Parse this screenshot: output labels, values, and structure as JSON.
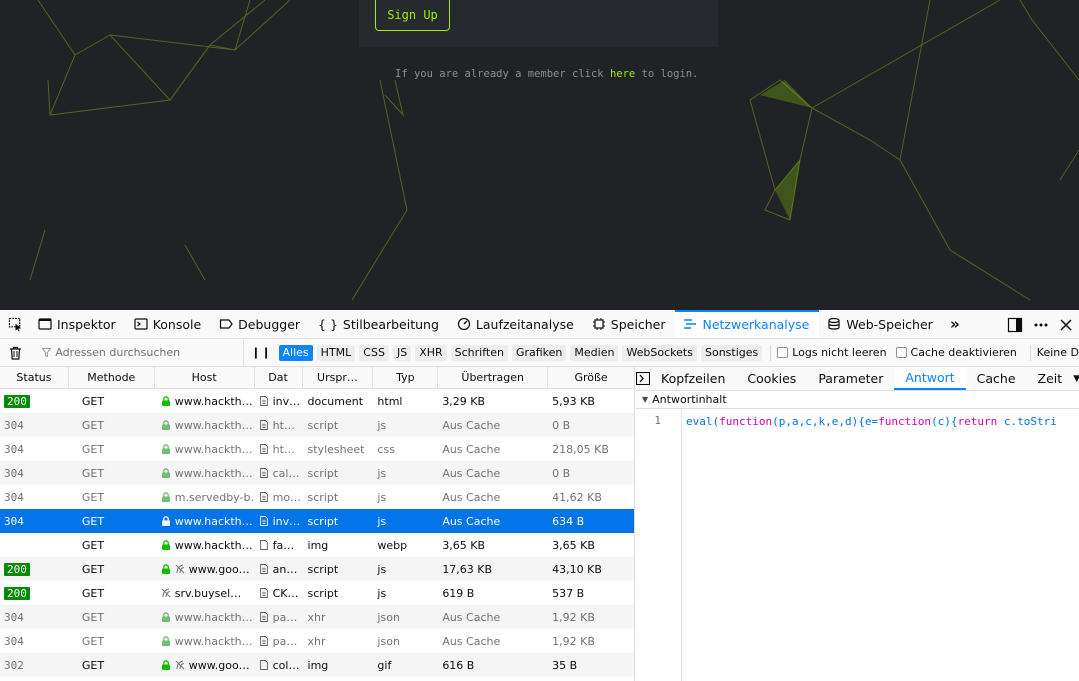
{
  "webpage": {
    "signup_label": "Sign Up",
    "login_prefix": "If you are already a member click ",
    "login_link": "here",
    "login_suffix": " to login.",
    "accent": "#9fef00"
  },
  "toolbox": {
    "tabs": [
      {
        "label": "Inspektor",
        "icon": "inspector-icon"
      },
      {
        "label": "Konsole",
        "icon": "console-icon"
      },
      {
        "label": "Debugger",
        "icon": "debugger-icon"
      },
      {
        "label": "Stilbearbeitung",
        "icon": "braces-icon",
        "prefix": "{ }"
      },
      {
        "label": "Laufzeitanalyse",
        "icon": "performance-icon"
      },
      {
        "label": "Speicher",
        "icon": "memory-icon"
      },
      {
        "label": "Netzwerkanalyse",
        "icon": "network-icon",
        "active": true
      },
      {
        "label": "Web-Speicher",
        "icon": "storage-icon"
      }
    ]
  },
  "net_toolbar": {
    "filter_placeholder": "Adressen durchsuchen",
    "type_filters": [
      "Alles",
      "HTML",
      "CSS",
      "JS",
      "XHR",
      "Schriften",
      "Grafiken",
      "Medien",
      "WebSockets",
      "Sonstiges"
    ],
    "active_filter": "Alles",
    "persist_logs": "Logs nicht leeren",
    "disable_cache": "Cache deaktivieren",
    "throttle": "Keine D"
  },
  "table": {
    "columns": [
      "Status",
      "Methode",
      "Host",
      "Dat",
      "Urspr…",
      "Typ",
      "Übertragen",
      "Größe"
    ],
    "rows": [
      {
        "status": "200",
        "method": "GET",
        "host": "www.hackth…",
        "file": "inv…",
        "cause": "document",
        "type": "html",
        "transferred": "3,29 KB",
        "size": "5,93 KB",
        "secure": true
      },
      {
        "status": "304",
        "method": "GET",
        "host": "www.hackth…",
        "file": "ht…",
        "cause": "script",
        "type": "js",
        "transferred": "Aus Cache",
        "size": "0 B",
        "secure": true
      },
      {
        "status": "304",
        "method": "GET",
        "host": "www.hackth…",
        "file": "ht…",
        "cause": "stylesheet",
        "type": "css",
        "transferred": "Aus Cache",
        "size": "218,05 KB",
        "secure": true
      },
      {
        "status": "304",
        "method": "GET",
        "host": "www.hackth…",
        "file": "cal…",
        "cause": "script",
        "type": "js",
        "transferred": "Aus Cache",
        "size": "0 B",
        "secure": true
      },
      {
        "status": "304",
        "method": "GET",
        "host": "m.servedby-b…",
        "file": "mo…",
        "cause": "script",
        "type": "js",
        "transferred": "Aus Cache",
        "size": "41,62 KB",
        "secure": true
      },
      {
        "status": "304",
        "method": "GET",
        "host": "www.hackth…",
        "file": "inv…",
        "cause": "script",
        "type": "js",
        "transferred": "Aus Cache",
        "size": "634 B",
        "secure": true,
        "selected": true
      },
      {
        "status": "",
        "method": "GET",
        "host": "www.hackth…",
        "file": "fa…",
        "cause": "img",
        "type": "webp",
        "transferred": "3,65 KB",
        "size": "3,65 KB",
        "secure": true
      },
      {
        "status": "200",
        "method": "GET",
        "host": "www.goo…",
        "file": "an…",
        "cause": "script",
        "type": "js",
        "transferred": "17,63 KB",
        "size": "43,10 KB",
        "secure": true,
        "tracker": true
      },
      {
        "status": "200",
        "method": "GET",
        "host": "srv.buysel…",
        "file": "CK…",
        "cause": "script",
        "type": "js",
        "transferred": "619 B",
        "size": "537 B",
        "secure": false,
        "tracker": true
      },
      {
        "status": "304",
        "method": "GET",
        "host": "www.hackth…",
        "file": "pa…",
        "cause": "xhr",
        "type": "json",
        "transferred": "Aus Cache",
        "size": "1,92 KB",
        "secure": true
      },
      {
        "status": "304",
        "method": "GET",
        "host": "www.hackth…",
        "file": "pa…",
        "cause": "xhr",
        "type": "json",
        "transferred": "Aus Cache",
        "size": "1,92 KB",
        "secure": true
      },
      {
        "status": "302",
        "method": "GET",
        "host": "www.goo…",
        "file": "col…",
        "cause": "img",
        "type": "gif",
        "transferred": "616 B",
        "size": "35 B",
        "secure": true,
        "tracker": true
      }
    ]
  },
  "side_panel": {
    "tabs": [
      "Kopfzeilen",
      "Cookies",
      "Parameter",
      "Antwort",
      "Cache",
      "Zeit"
    ],
    "active_tab": "Antwort",
    "section_title": "Antwortinhalt",
    "line_number": "1",
    "code_line": "eval(function(p,a,c,k,e,d){e=function(c){return c.toStri"
  }
}
